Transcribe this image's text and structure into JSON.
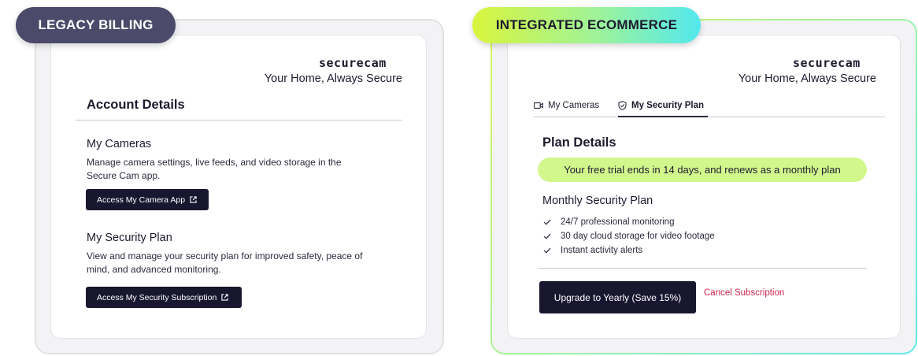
{
  "badges": {
    "legacy": "LEGACY BILLING",
    "integrated": "INTEGRATED ECOMMERCE"
  },
  "colors": {
    "primary_button": "#191730",
    "trial_banner": "#d2f78c",
    "cancel_link": "#d0264e",
    "legacy_badge": "#4c4a6a"
  },
  "legacy": {
    "logo": "securecam",
    "tagline": "Your Home, Always Secure",
    "heading": "Account Details",
    "cameras": {
      "title": "My Cameras",
      "description_line1": "Manage camera settings, live feeds, and video storage in the",
      "description_line2": "Secure Cam app.",
      "button": "Access My Camera App",
      "button_icon": "external-link-icon"
    },
    "security": {
      "title": "My Security Plan",
      "description_line1": "View and manage your security plan for improved safety, peace of",
      "description_line2": "mind, and advanced monitoring.",
      "button": "Access My Security Subscription",
      "button_icon": "external-link-icon"
    }
  },
  "integrated": {
    "logo": "securecam",
    "tagline": "Your Home, Always Secure",
    "tabs": [
      {
        "label": "My Cameras",
        "icon": "video-camera-icon",
        "active": false
      },
      {
        "label": "My Security Plan",
        "icon": "shield-check-icon",
        "active": true
      }
    ],
    "plan_heading": "Plan Details",
    "trial_banner": "Your free trial ends in 14 days, and renews as a monthly plan",
    "plan_name": "Monthly Security Plan",
    "features": [
      "24/7 professional monitoring",
      "30 day cloud storage for video footage",
      "Instant activity alerts"
    ],
    "upgrade_button": "Upgrade to Yearly (Save 15%)",
    "cancel_link": "Cancel Subscription"
  }
}
